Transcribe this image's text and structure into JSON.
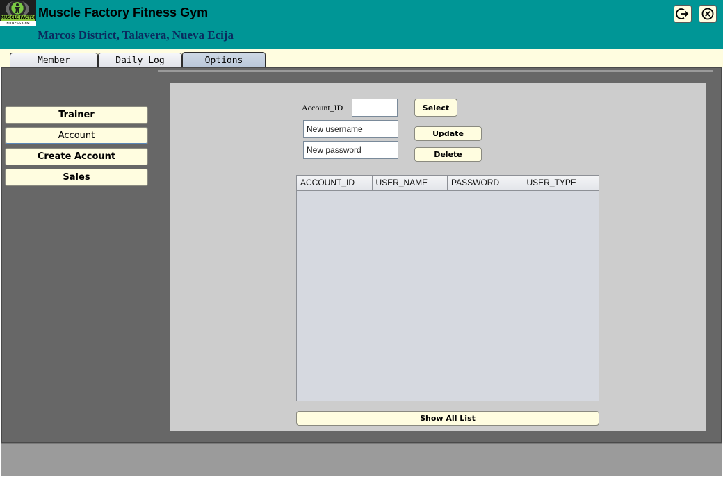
{
  "header": {
    "title": "Muscle Factory Fitness Gym",
    "address": "Marcos District, Talavera, Nueva Ecija",
    "logo_text": "MUSCLE FACTORY",
    "logo_subtext": "FITNESS GYM",
    "logout_icon": "logout-icon",
    "close_icon": "close-icon",
    "color": "#009696"
  },
  "tabs": [
    {
      "label": "Member"
    },
    {
      "label": "Daily Log"
    },
    {
      "label": "Options",
      "active": true
    }
  ],
  "sidebar": {
    "items": [
      {
        "label": "Trainer"
      },
      {
        "label": "Account",
        "active": true
      },
      {
        "label": "Create Account"
      },
      {
        "label": "Sales"
      }
    ]
  },
  "form": {
    "account_id_label": "Account_ID",
    "account_id_value": "",
    "username_placeholder": "New username",
    "password_placeholder": "New password",
    "select_label": "Select",
    "update_label": "Update",
    "delete_label": "Delete"
  },
  "table": {
    "columns": [
      "ACCOUNT_ID",
      "USER_NAME",
      "PASSWORD",
      "USER_TYPE"
    ],
    "rows": []
  },
  "show_all_label": "Show All List"
}
